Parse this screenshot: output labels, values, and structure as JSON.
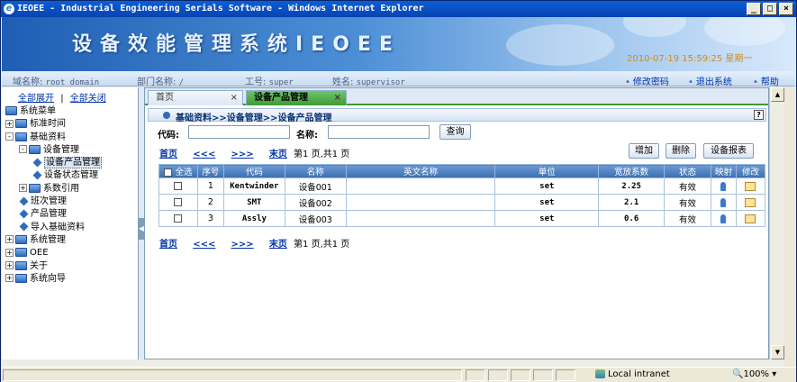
{
  "window": {
    "title": "IEOEE - Industrial Engineering Serials Software - Windows Internet Explorer",
    "controls": [
      "_",
      "□",
      "×"
    ]
  },
  "banner": {
    "system_name": "设备效能管理系统IEOEE",
    "datetime": "2010-07-19 15:59:25 星期一"
  },
  "infobar": {
    "domain_label": "域名称:",
    "domain_value": "root domain",
    "dept_label": "部门名称:",
    "dept_value": "/",
    "empno_label": "工号:",
    "empno_value": "super",
    "name_label": "姓名:",
    "name_value": "supervisor",
    "links": {
      "change_password": "修改密码",
      "logout": "退出系统",
      "help": "帮助"
    }
  },
  "sidebar": {
    "expand_all": "全部展开",
    "separator": "|",
    "collapse_all": "全部关闭",
    "tree": [
      {
        "label": "系统菜单",
        "level": 0,
        "kind": "root"
      },
      {
        "label": "标准时间",
        "level": 0,
        "kind": "folder",
        "pm": "+"
      },
      {
        "label": "基础资料",
        "level": 0,
        "kind": "folder",
        "pm": "-"
      },
      {
        "label": "设备管理",
        "level": 1,
        "kind": "folder",
        "pm": "-"
      },
      {
        "label": "设备产品管理",
        "level": 2,
        "kind": "leaf",
        "selected": true
      },
      {
        "label": "设备状态管理",
        "level": 2,
        "kind": "leaf"
      },
      {
        "label": "系数引用",
        "level": 1,
        "kind": "folder",
        "pm": "+"
      },
      {
        "label": "班次管理",
        "level": 1,
        "kind": "leaf"
      },
      {
        "label": "产品管理",
        "level": 1,
        "kind": "leaf"
      },
      {
        "label": "导入基础资料",
        "level": 1,
        "kind": "leaf"
      },
      {
        "label": "系统管理",
        "level": 0,
        "kind": "folder",
        "pm": "+"
      },
      {
        "label": "OEE",
        "level": 0,
        "kind": "folder",
        "pm": "+"
      },
      {
        "label": "关于",
        "level": 0,
        "kind": "folder",
        "pm": "+"
      },
      {
        "label": "系统向导",
        "level": 0,
        "kind": "folder",
        "pm": "+"
      }
    ]
  },
  "tabs": [
    {
      "label": "首页",
      "close": "×"
    },
    {
      "label": "设备产品管理",
      "close": "×"
    }
  ],
  "breadcrumb": "基础资料>>设备管理>>设备产品管理",
  "help_icon_label": "?",
  "search": {
    "code_label": "代码:",
    "code_value": "",
    "name_label": "名称:",
    "name_value": "",
    "query_button": "查询"
  },
  "toolbar": {
    "add": "增加",
    "delete": "删除",
    "report": "设备报表"
  },
  "pager": {
    "first": "首页",
    "prev": "<<<",
    "next": ">>>",
    "last": "末页",
    "info": "第1 页,共1 页"
  },
  "table": {
    "headers": [
      "全选",
      "序号",
      "代码",
      "名称",
      "英文名称",
      "单位",
      "宽放系数",
      "状态",
      "映射",
      "修改"
    ],
    "rows": [
      {
        "seq": "1",
        "code": "Kentwinder",
        "name": "设备001",
        "en_name": "",
        "unit": "set",
        "factor": "2.25",
        "status": "有效"
      },
      {
        "seq": "2",
        "code": "SMT",
        "name": "设备002",
        "en_name": "",
        "unit": "set",
        "factor": "2.1",
        "status": "有效"
      },
      {
        "seq": "3",
        "code": "Assly",
        "name": "设备003",
        "en_name": "",
        "unit": "set",
        "factor": "0.6",
        "status": "有效"
      }
    ]
  },
  "statusbar": {
    "zone": "Local intranet",
    "zoom": "100%"
  },
  "colors": {
    "tab_active": "#3f9b35",
    "header_blue": "#3c6eb4",
    "link": "#0033aa",
    "date_orange": "#d08a1a"
  }
}
